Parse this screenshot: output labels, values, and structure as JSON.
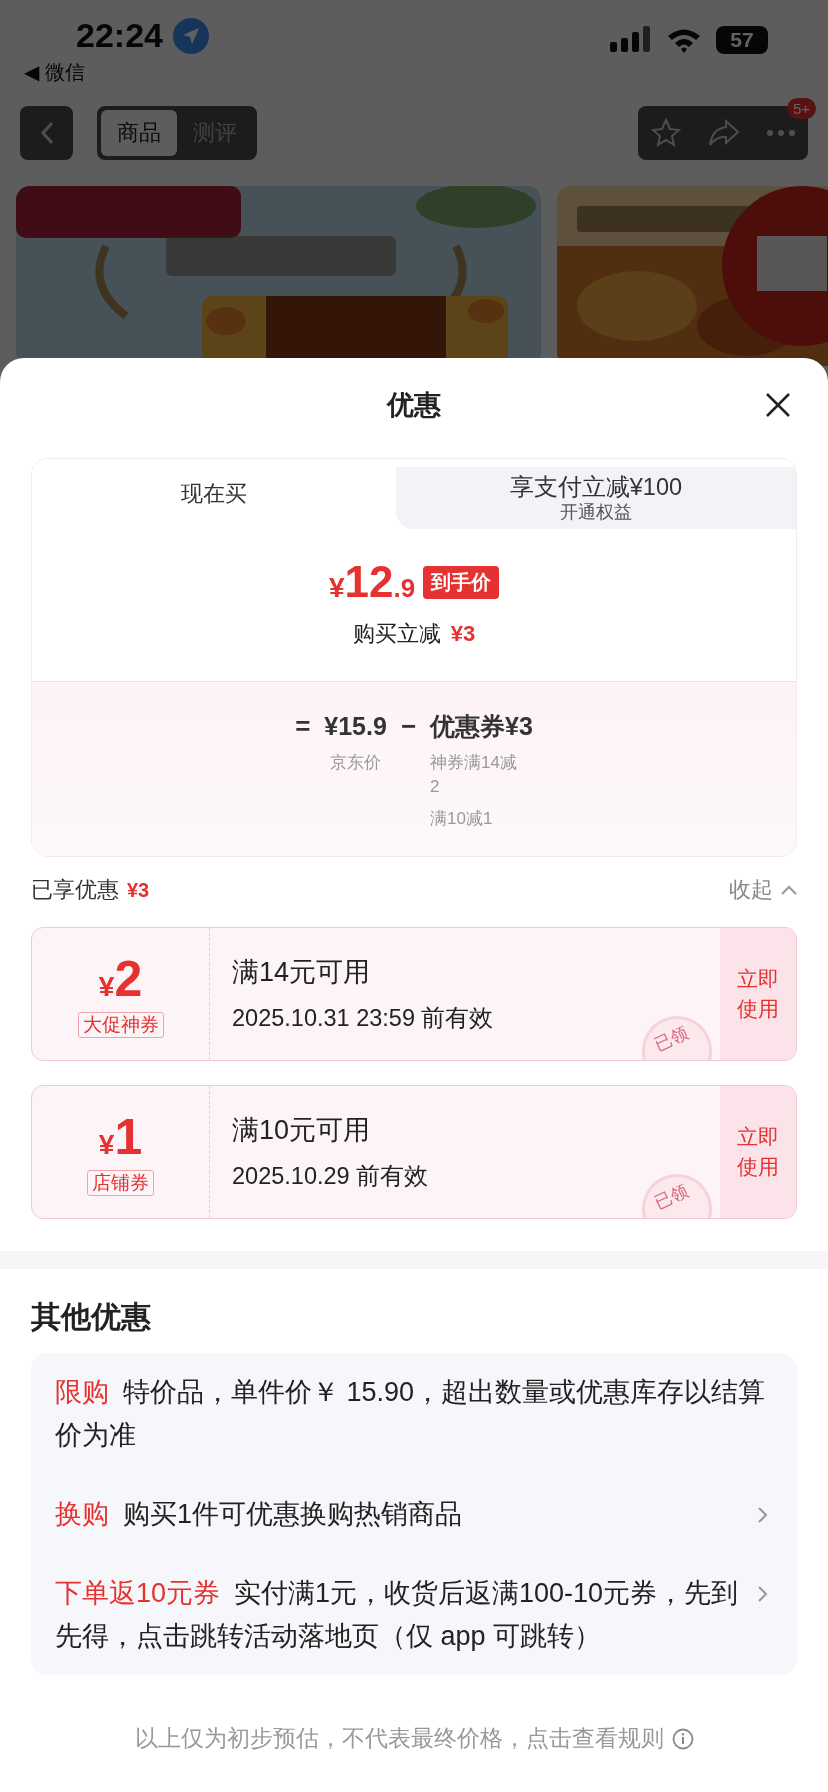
{
  "status_bar": {
    "time": "22:24",
    "back_app": "◀ 微信",
    "battery": "57"
  },
  "nav": {
    "tabs": [
      {
        "label": "商品",
        "selected": true
      },
      {
        "label": "测评",
        "selected": false
      }
    ],
    "badge": "5+"
  },
  "sheet": {
    "title": "优惠",
    "price_tabs": [
      {
        "label": "现在买",
        "selected": true
      },
      {
        "label": "享支付立减¥100",
        "sublabel": "开通权益",
        "selected": false
      }
    ],
    "final_price": {
      "currency": "¥",
      "integer": "12",
      "decimal": ".9",
      "tag": "到手价"
    },
    "saving": {
      "label": "购买立减",
      "amount": "¥3"
    },
    "breakdown": {
      "equals": "=",
      "base_value": "¥15.9",
      "base_label": "京东价",
      "minus": "−",
      "coupon_value": "优惠券¥3",
      "coupon_notes": [
        "神券满14减2",
        "满10减1"
      ]
    },
    "applied": {
      "label": "已享优惠",
      "amount": "¥3",
      "toggle": "收起"
    },
    "coupons": [
      {
        "currency": "¥",
        "amount": "2",
        "tag": "大促神券",
        "condition": "满14元可用",
        "validity": "2025.10.31 23:59 前有效",
        "stamp": "已领",
        "action": "立即使用"
      },
      {
        "currency": "¥",
        "amount": "1",
        "tag": "店铺券",
        "condition": "满10元可用",
        "validity": "2025.10.29 前有效",
        "stamp": "已领",
        "action": "立即使用"
      }
    ],
    "other": {
      "title": "其他优惠",
      "items": [
        {
          "tag": "限购",
          "text": "特价品，单件价￥ 15.90，超出数量或优惠库存以结算价为准",
          "arrow": false
        },
        {
          "tag": "换购",
          "text": "购买1件可优惠换购热销商品",
          "arrow": true
        },
        {
          "tag": "下单返10元券",
          "text": "实付满1元，收货后返满100-10元券，先到先得，点击跳转活动落地页（仅 app 可跳转）",
          "arrow": true
        }
      ]
    },
    "footer": "以上仅为初步预估，不代表最终价格，点击查看规则"
  }
}
